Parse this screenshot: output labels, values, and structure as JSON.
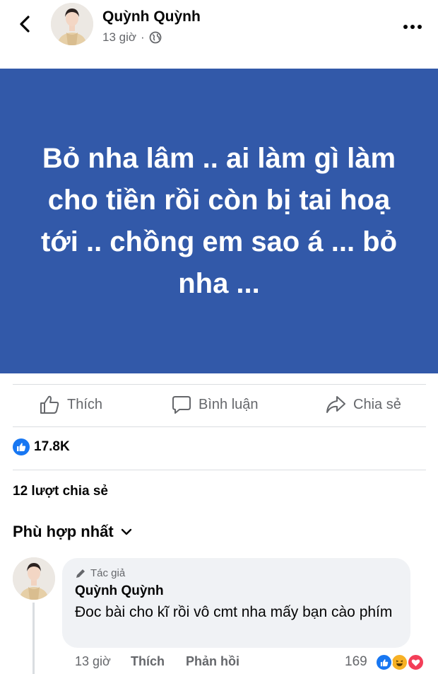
{
  "header": {
    "author_name": "Quỳnh Quỳnh",
    "time": "13 giờ",
    "separator": "·",
    "icons": {
      "back": "chevron-left-icon",
      "privacy": "globe-icon",
      "more": "more-horizontal-icon"
    }
  },
  "post": {
    "text": "Bỏ nha lâm .. ai làm gì làm cho tiền rồi còn bị tai hoạ tới .. chồng em sao á ... bỏ nha ...",
    "background_color": "#3259a9",
    "text_color": "#ffffff"
  },
  "actions": {
    "like_label": "Thích",
    "comment_label": "Bình luận",
    "share_label": "Chia sẻ"
  },
  "reactions": {
    "count": "17.8K",
    "icon": "like-reaction-icon"
  },
  "shares": {
    "text": "12 lượt chia sẻ"
  },
  "comments_sort": {
    "label": "Phù hợp nhất",
    "icon": "chevron-down-icon"
  },
  "comment": {
    "author_badge": "Tác giả",
    "author_name": "Quỳnh Quỳnh",
    "text": "Đoc bài cho kĩ rồi vô cmt nha mấy bạn cào phím",
    "time": "13 giờ",
    "like_label": "Thích",
    "reply_label": "Phản hồi",
    "reaction_count": "169",
    "reaction_icons": [
      "like-reaction-icon",
      "haha-reaction-icon",
      "love-reaction-icon"
    ]
  },
  "colors": {
    "accent": "#1877f2",
    "secondary_text": "#65676b",
    "bubble": "#f0f2f5",
    "love": "#f33e58",
    "haha": "#f7b125"
  }
}
